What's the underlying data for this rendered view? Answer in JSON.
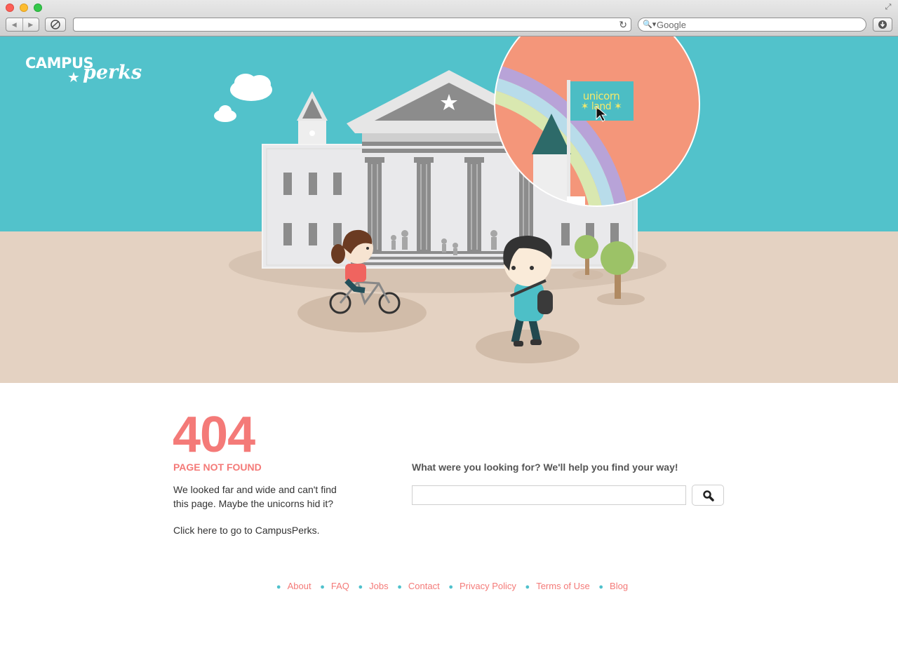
{
  "browser": {
    "search_placeholder": "Google"
  },
  "brand": {
    "word1": "CAMPUS",
    "star": "★",
    "word2": "perks"
  },
  "illustration": {
    "flag_line1": "unicorn",
    "flag_line2": "✶ land ✶"
  },
  "error": {
    "code": "404",
    "title": "PAGE NOT FOUND",
    "message": "We looked far and wide and can't find this page. Maybe the unicorns hid it?",
    "home_link": "Click here to go to CampusPerks."
  },
  "search": {
    "label": "What were you looking for? We'll help you find your way!",
    "button_icon": "magnifier-icon"
  },
  "footer": {
    "links": [
      "About",
      "FAQ",
      "Jobs",
      "Contact",
      "Privacy Policy",
      "Terms of Use",
      "Blog"
    ]
  },
  "colors": {
    "sky": "#52c2cb",
    "ground": "#e4d2c2",
    "accent": "#f47a78",
    "bullet": "#4fc1cc"
  }
}
